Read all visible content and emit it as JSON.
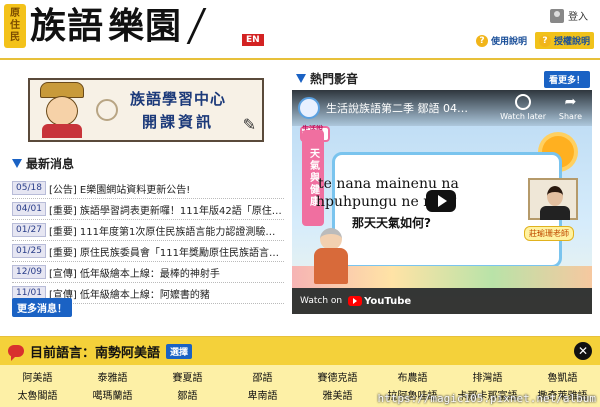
{
  "header": {
    "logo_badge": [
      "原",
      "住",
      "民"
    ],
    "logo_text": "族語",
    "logo_text2": "樂園",
    "en_label": "EN",
    "login_label": "登入",
    "use_guide": "使用說明",
    "teach_guide": "授權說明"
  },
  "banner": {
    "line1": "族語學習中心",
    "line2": "開課資訊"
  },
  "news": {
    "title": "最新消息",
    "items": [
      {
        "date": "05/18",
        "text": "[公告] E樂園網站資料更新公告!"
      },
      {
        "date": "04/01",
        "text": "[重要] 族語學習詞表更新囉！111年版42語「原住民族語言學…"
      },
      {
        "date": "01/27",
        "text": "[重要] 111年度第1次原住民族語言能力認證測驗報名開始"
      },
      {
        "date": "01/25",
        "text": "[重要] 原住民族委員會「111年獎勵原住民族語言發展實施計…"
      },
      {
        "date": "12/09",
        "text": "[宣傳] 低年級繪本上線：最棒的神射手"
      },
      {
        "date": "11/01",
        "text": "[宣傳] 低年級繪本上線：阿嬤書的豬"
      }
    ],
    "more_label": "更多消息！"
  },
  "video": {
    "section_title": "熱門影音",
    "more_label": "看更多！",
    "title": "生活說族語第二季 鄒語 04天氣…",
    "watch_later": "Watch later",
    "share": "Share",
    "show_logo": "生活說族語",
    "side_tag": "天氣與健康",
    "board_line1": "te nana mainenu na",
    "board_line2": "hpuhpungu ne mio?",
    "board_line3": "那天天氣如何?",
    "teacher_tag": "莊瑜珊老師",
    "watch_on": "Watch on",
    "yt_label": "YouTube"
  },
  "languages": {
    "current": "目前語言：南勢阿美語",
    "select_label": "選擇",
    "close_label": "✕",
    "row1": [
      "阿美語",
      "泰雅語",
      "賽夏語",
      "邵語",
      "賽德克語",
      "布農語",
      "排灣語",
      "魯凱語"
    ],
    "row2": [
      "太魯閣語",
      "噶瑪蘭語",
      "鄒語",
      "卑南語",
      "雅美語",
      "拉阿魯哇語",
      "卡那卡那富語",
      "撒奇萊雅語"
    ]
  },
  "watermark": "https://magic105.pixnet.net/album"
}
